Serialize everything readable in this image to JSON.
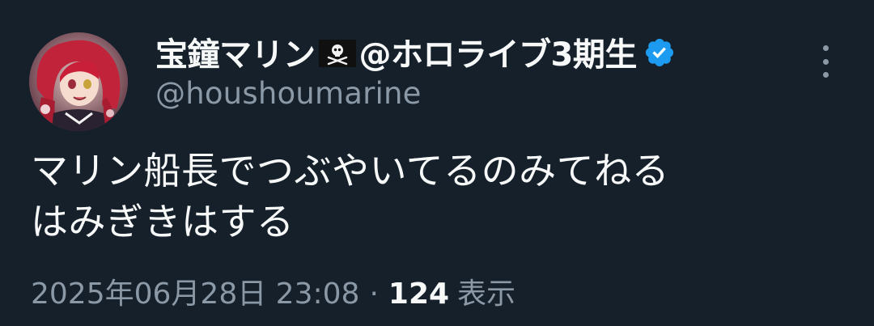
{
  "author": {
    "display_name": "宝鐘マリン",
    "flag_emoji": "pirate-flag-icon",
    "display_name_suffix": "@ホロライブ3期生",
    "handle": "@houshoumarine",
    "verified": true
  },
  "tweet": {
    "lines": [
      "マリン船長でつぶやいてるのみてねる",
      "はみぎきはする"
    ]
  },
  "meta": {
    "timestamp": "2025年06月28日 23:08",
    "separator": "·",
    "views_count": "124",
    "views_label": "表示"
  },
  "colors": {
    "background": "#15202b",
    "text_primary": "#f7f9f9",
    "text_secondary": "#8b98a5",
    "verified_blue": "#1d9bf0"
  }
}
